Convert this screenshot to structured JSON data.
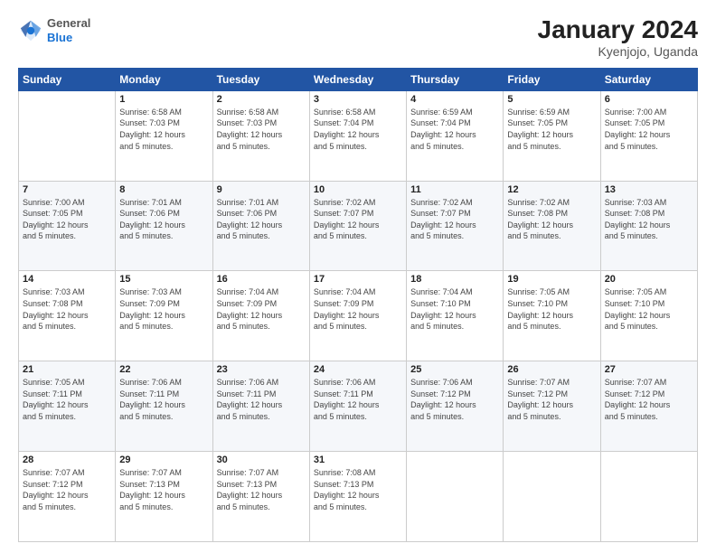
{
  "header": {
    "logo_general": "General",
    "logo_blue": "Blue",
    "month_year": "January 2024",
    "location": "Kyenjojo, Uganda"
  },
  "weekdays": [
    "Sunday",
    "Monday",
    "Tuesday",
    "Wednesday",
    "Thursday",
    "Friday",
    "Saturday"
  ],
  "weeks": [
    [
      {
        "day": "",
        "info": ""
      },
      {
        "day": "1",
        "info": "Sunrise: 6:58 AM\nSunset: 7:03 PM\nDaylight: 12 hours\nand 5 minutes."
      },
      {
        "day": "2",
        "info": "Sunrise: 6:58 AM\nSunset: 7:03 PM\nDaylight: 12 hours\nand 5 minutes."
      },
      {
        "day": "3",
        "info": "Sunrise: 6:58 AM\nSunset: 7:04 PM\nDaylight: 12 hours\nand 5 minutes."
      },
      {
        "day": "4",
        "info": "Sunrise: 6:59 AM\nSunset: 7:04 PM\nDaylight: 12 hours\nand 5 minutes."
      },
      {
        "day": "5",
        "info": "Sunrise: 6:59 AM\nSunset: 7:05 PM\nDaylight: 12 hours\nand 5 minutes."
      },
      {
        "day": "6",
        "info": "Sunrise: 7:00 AM\nSunset: 7:05 PM\nDaylight: 12 hours\nand 5 minutes."
      }
    ],
    [
      {
        "day": "7",
        "info": "Sunrise: 7:00 AM\nSunset: 7:05 PM\nDaylight: 12 hours\nand 5 minutes."
      },
      {
        "day": "8",
        "info": "Sunrise: 7:01 AM\nSunset: 7:06 PM\nDaylight: 12 hours\nand 5 minutes."
      },
      {
        "day": "9",
        "info": "Sunrise: 7:01 AM\nSunset: 7:06 PM\nDaylight: 12 hours\nand 5 minutes."
      },
      {
        "day": "10",
        "info": "Sunrise: 7:02 AM\nSunset: 7:07 PM\nDaylight: 12 hours\nand 5 minutes."
      },
      {
        "day": "11",
        "info": "Sunrise: 7:02 AM\nSunset: 7:07 PM\nDaylight: 12 hours\nand 5 minutes."
      },
      {
        "day": "12",
        "info": "Sunrise: 7:02 AM\nSunset: 7:08 PM\nDaylight: 12 hours\nand 5 minutes."
      },
      {
        "day": "13",
        "info": "Sunrise: 7:03 AM\nSunset: 7:08 PM\nDaylight: 12 hours\nand 5 minutes."
      }
    ],
    [
      {
        "day": "14",
        "info": "Sunrise: 7:03 AM\nSunset: 7:08 PM\nDaylight: 12 hours\nand 5 minutes."
      },
      {
        "day": "15",
        "info": "Sunrise: 7:03 AM\nSunset: 7:09 PM\nDaylight: 12 hours\nand 5 minutes."
      },
      {
        "day": "16",
        "info": "Sunrise: 7:04 AM\nSunset: 7:09 PM\nDaylight: 12 hours\nand 5 minutes."
      },
      {
        "day": "17",
        "info": "Sunrise: 7:04 AM\nSunset: 7:09 PM\nDaylight: 12 hours\nand 5 minutes."
      },
      {
        "day": "18",
        "info": "Sunrise: 7:04 AM\nSunset: 7:10 PM\nDaylight: 12 hours\nand 5 minutes."
      },
      {
        "day": "19",
        "info": "Sunrise: 7:05 AM\nSunset: 7:10 PM\nDaylight: 12 hours\nand 5 minutes."
      },
      {
        "day": "20",
        "info": "Sunrise: 7:05 AM\nSunset: 7:10 PM\nDaylight: 12 hours\nand 5 minutes."
      }
    ],
    [
      {
        "day": "21",
        "info": "Sunrise: 7:05 AM\nSunset: 7:11 PM\nDaylight: 12 hours\nand 5 minutes."
      },
      {
        "day": "22",
        "info": "Sunrise: 7:06 AM\nSunset: 7:11 PM\nDaylight: 12 hours\nand 5 minutes."
      },
      {
        "day": "23",
        "info": "Sunrise: 7:06 AM\nSunset: 7:11 PM\nDaylight: 12 hours\nand 5 minutes."
      },
      {
        "day": "24",
        "info": "Sunrise: 7:06 AM\nSunset: 7:11 PM\nDaylight: 12 hours\nand 5 minutes."
      },
      {
        "day": "25",
        "info": "Sunrise: 7:06 AM\nSunset: 7:12 PM\nDaylight: 12 hours\nand 5 minutes."
      },
      {
        "day": "26",
        "info": "Sunrise: 7:07 AM\nSunset: 7:12 PM\nDaylight: 12 hours\nand 5 minutes."
      },
      {
        "day": "27",
        "info": "Sunrise: 7:07 AM\nSunset: 7:12 PM\nDaylight: 12 hours\nand 5 minutes."
      }
    ],
    [
      {
        "day": "28",
        "info": "Sunrise: 7:07 AM\nSunset: 7:12 PM\nDaylight: 12 hours\nand 5 minutes."
      },
      {
        "day": "29",
        "info": "Sunrise: 7:07 AM\nSunset: 7:13 PM\nDaylight: 12 hours\nand 5 minutes."
      },
      {
        "day": "30",
        "info": "Sunrise: 7:07 AM\nSunset: 7:13 PM\nDaylight: 12 hours\nand 5 minutes."
      },
      {
        "day": "31",
        "info": "Sunrise: 7:08 AM\nSunset: 7:13 PM\nDaylight: 12 hours\nand 5 minutes."
      },
      {
        "day": "",
        "info": ""
      },
      {
        "day": "",
        "info": ""
      },
      {
        "day": "",
        "info": ""
      }
    ]
  ]
}
